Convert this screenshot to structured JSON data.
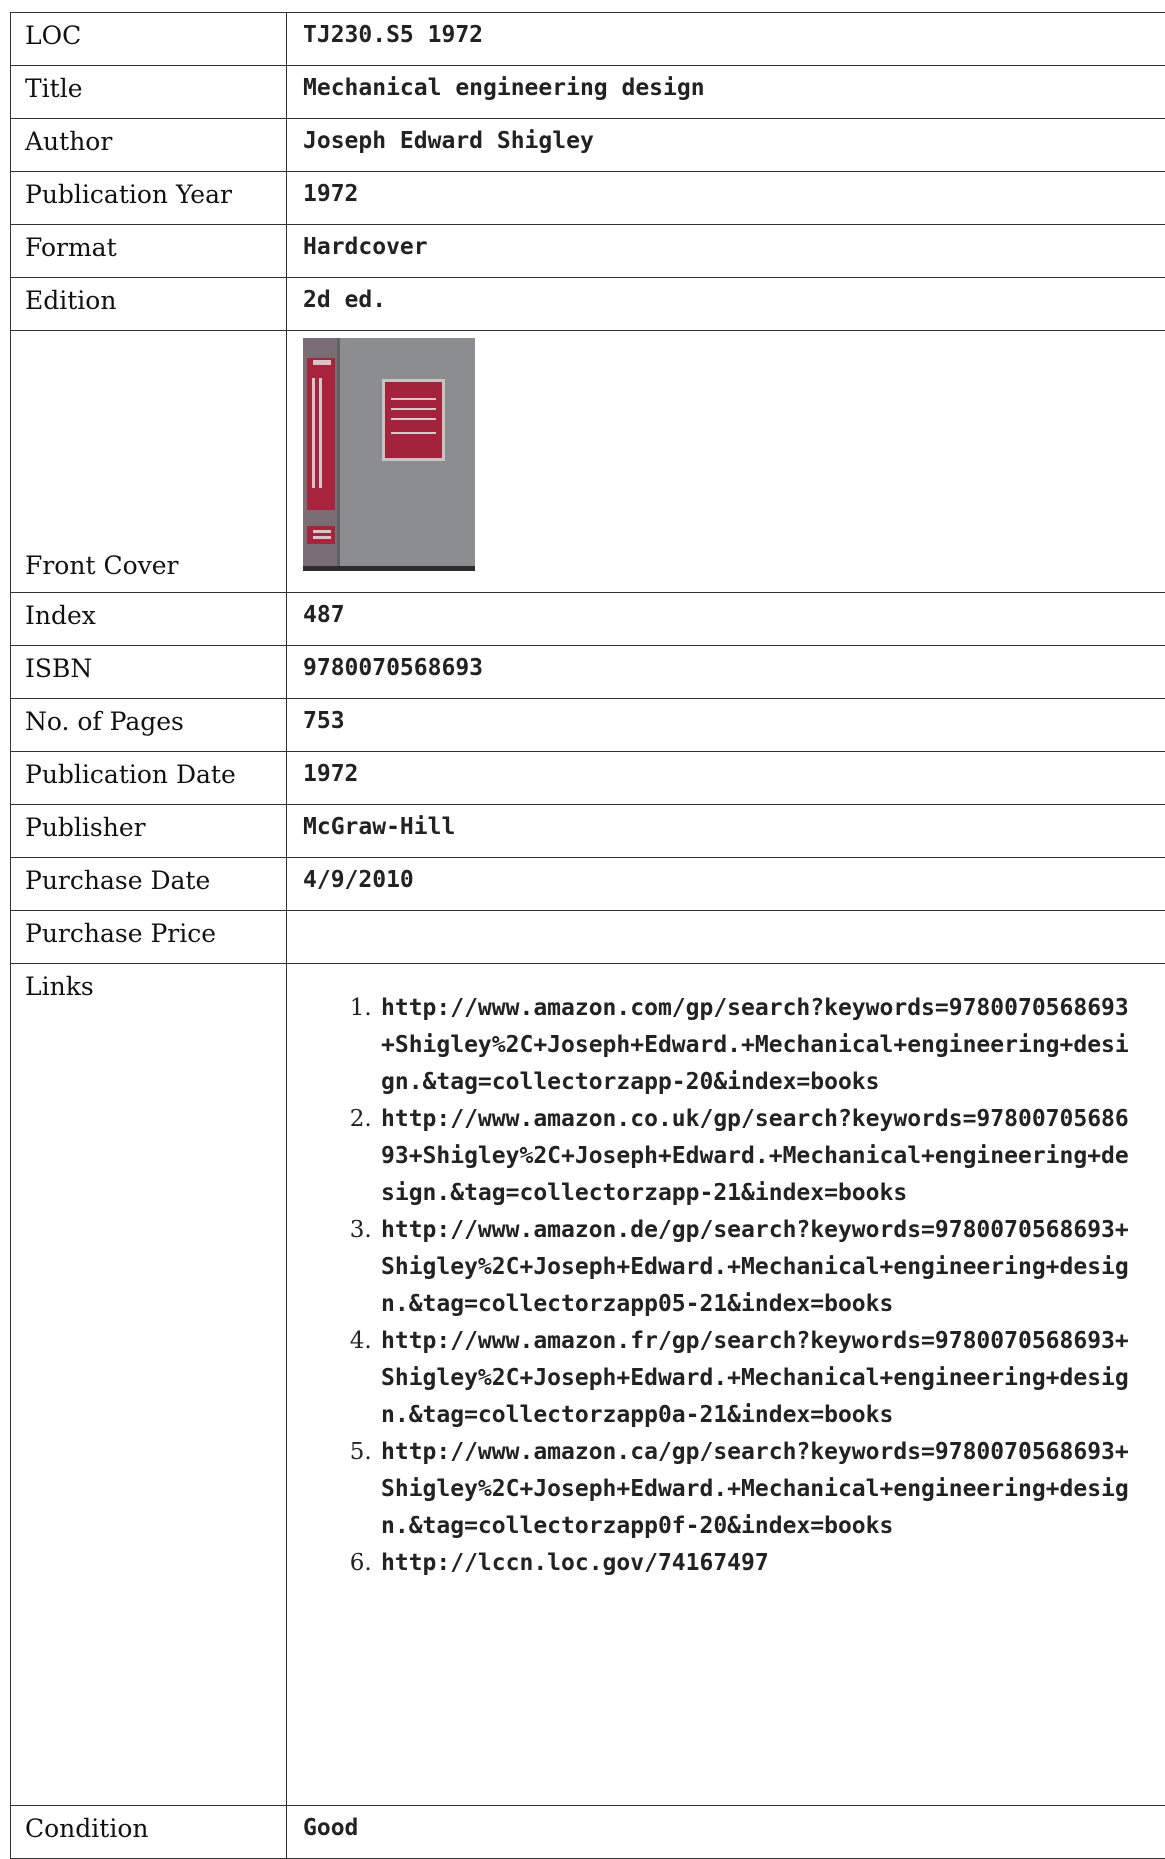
{
  "rows": {
    "loc": {
      "label": "LOC",
      "value": "TJ230.S5 1972"
    },
    "title": {
      "label": "Title",
      "value": "Mechanical engineering design"
    },
    "author": {
      "label": "Author",
      "value": "Joseph Edward Shigley"
    },
    "publication_year": {
      "label": "Publication Year",
      "value": "1972"
    },
    "format": {
      "label": "Format",
      "value": "Hardcover"
    },
    "edition": {
      "label": "Edition",
      "value": "2d ed."
    },
    "front_cover": {
      "label": "Front Cover",
      "image": "book-cover-image",
      "cover_color": "#8a8c8e",
      "spine_color": "#b0243e"
    },
    "index": {
      "label": "Index",
      "value": "487"
    },
    "isbn": {
      "label": "ISBN",
      "value": "9780070568693"
    },
    "pages": {
      "label": "No. of Pages",
      "value": "753"
    },
    "publication_date": {
      "label": "Publication Date",
      "value": "1972"
    },
    "publisher": {
      "label": "Publisher",
      "value": "McGraw-Hill"
    },
    "purchase_date": {
      "label": "Purchase Date",
      "value": "4/9/2010"
    },
    "purchase_price": {
      "label": "Purchase Price",
      "value": ""
    },
    "links": {
      "label": "Links",
      "items": [
        "http://www.amazon.com/gp/search?keywords=9780070568693+Shigley%2C+Joseph+Edward.+Mechanical+engineering+design.&tag=collectorzapp-20&index=books",
        "http://www.amazon.co.uk/gp/search?keywords=9780070568693+Shigley%2C+Joseph+Edward.+Mechanical+engineering+design.&tag=collectorzapp-21&index=books",
        "http://www.amazon.de/gp/search?keywords=9780070568693+Shigley%2C+Joseph+Edward.+Mechanical+engineering+design.&tag=collectorzapp05-21&index=books",
        "http://www.amazon.fr/gp/search?keywords=9780070568693+Shigley%2C+Joseph+Edward.+Mechanical+engineering+design.&tag=collectorzapp0a-21&index=books",
        "http://www.amazon.ca/gp/search?keywords=9780070568693+Shigley%2C+Joseph+Edward.+Mechanical+engineering+design.&tag=collectorzapp0f-20&index=books",
        "http://lccn.loc.gov/74167497"
      ]
    },
    "condition": {
      "label": "Condition",
      "value": "Good"
    }
  }
}
